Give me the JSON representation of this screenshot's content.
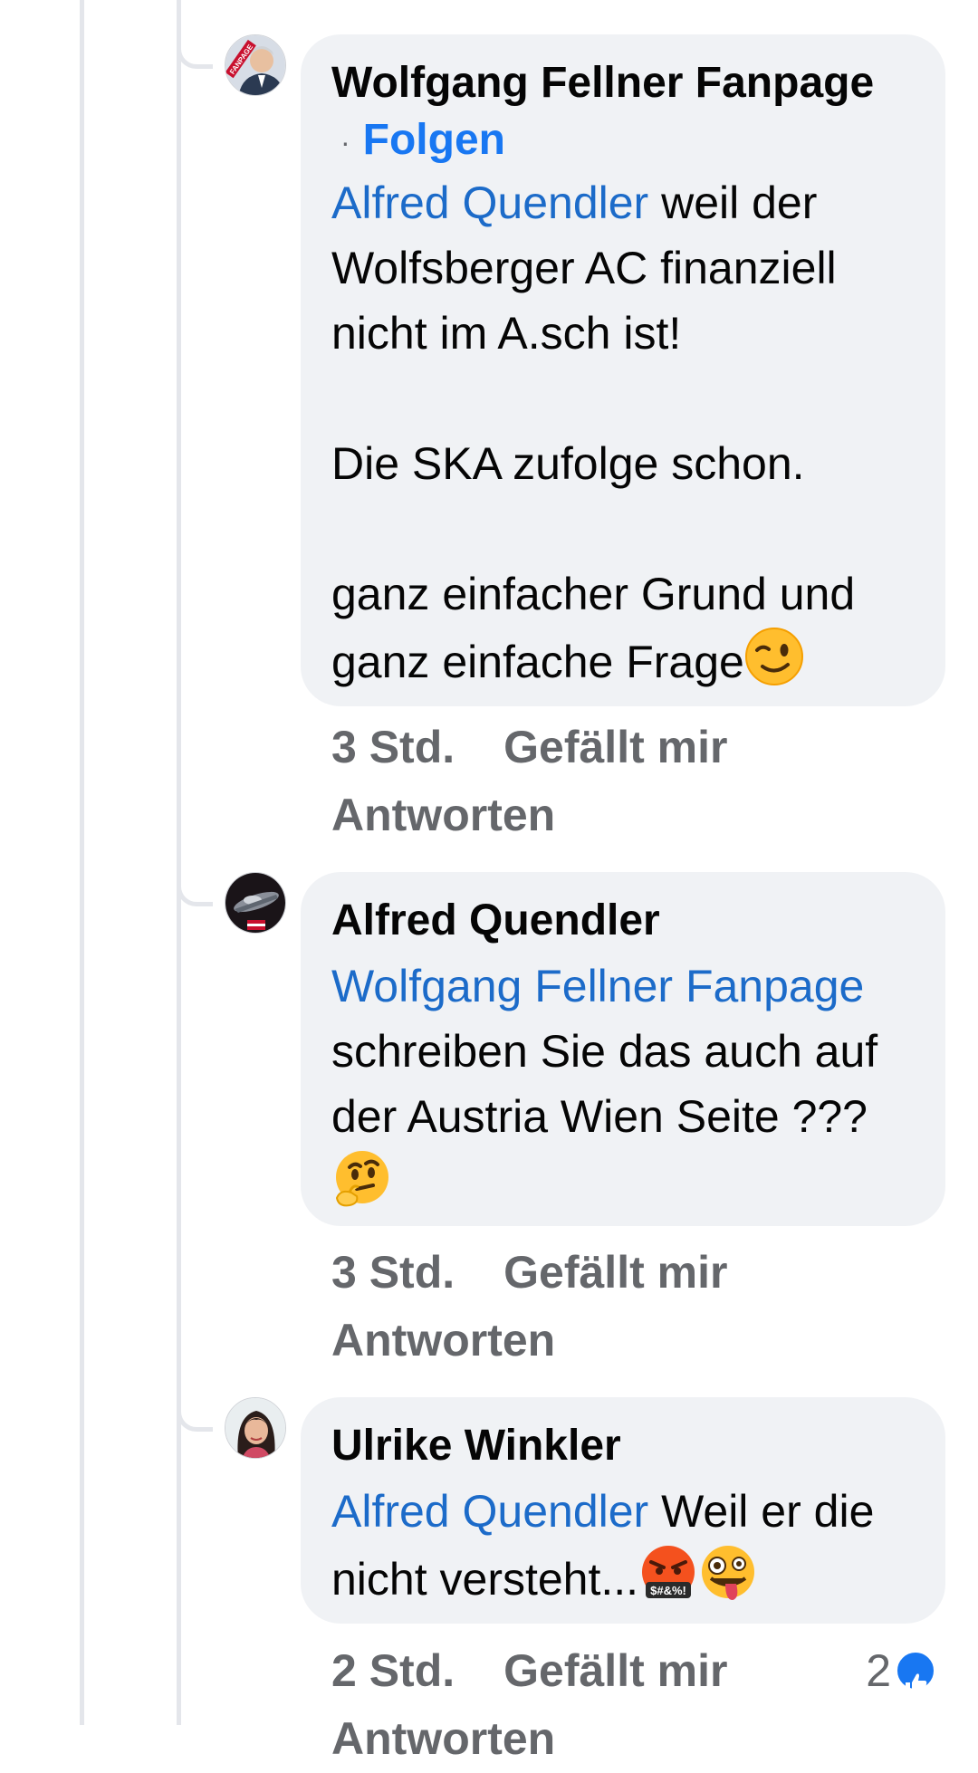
{
  "comments": [
    {
      "author": "Wolfgang Fellner Fanpage",
      "dot": "·",
      "follow_label": "Folgen",
      "avatar_badge": "FANPAGE",
      "mention": "Alfred Quendler",
      "line1_rest": " weil der Wolfsberger AC finanziell nicht im  A.sch ist!",
      "para2": "Die SKA zufolge schon.",
      "para3": "ganz einfacher Grund und ganz einfache Frage",
      "emoji_end": "winking-face",
      "time": "3 Std.",
      "like_label": "Gefällt mir",
      "reply_label": "Antworten"
    },
    {
      "author": "Alfred Quendler",
      "mention": "Wolfgang Fellner Fanpage",
      "text_rest": " schreiben Sie das auch auf der Austria Wien Seite ??? ",
      "emoji_end": "thinking-face",
      "time": "3 Std.",
      "like_label": "Gefällt mir",
      "reply_label": "Antworten"
    },
    {
      "author": "Ulrike Winkler",
      "mention": "Alfred Quendler",
      "text_rest": " Weil er die nicht versteht...",
      "emoji_end": [
        "face-with-symbols-on-mouth",
        "zany-face"
      ],
      "emoji_text": "$#&%!",
      "time": "2 Std.",
      "like_label": "Gefällt mir",
      "reply_label": "Antworten",
      "reaction_count": "2",
      "reaction_icon": "thumbs-up-icon"
    }
  ],
  "colors": {
    "mention": "#1c6bc9",
    "follow": "#1877f2",
    "meta": "#65676b",
    "bubble": "#f0f2f5",
    "thread_line": "#e4e6eb"
  }
}
